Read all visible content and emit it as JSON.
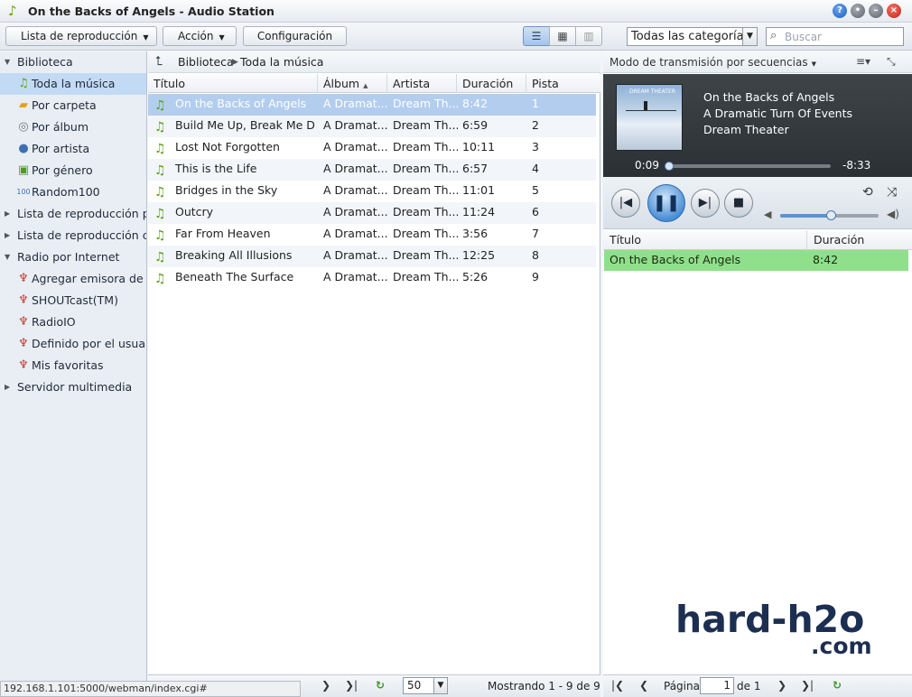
{
  "window": {
    "title": "On the Backs of Angels - Audio Station",
    "icon": "music-note-icon"
  },
  "toolbar": {
    "playlist_label": "Lista de reproducción",
    "action_label": "Acción",
    "settings_label": "Configuración",
    "category_value": "Todas las categorías",
    "search_placeholder": "Buscar"
  },
  "sidebar": {
    "library": {
      "label": "Biblioteca",
      "expanded": true
    },
    "library_items": [
      {
        "label": "Toda la música",
        "icon": "music-note-icon",
        "selected": true
      },
      {
        "label": "Por carpeta",
        "icon": "folder-icon"
      },
      {
        "label": "Por álbum",
        "icon": "disc-icon"
      },
      {
        "label": "Por artista",
        "icon": "person-icon"
      },
      {
        "label": "Por género",
        "icon": "genre-grid-icon"
      },
      {
        "label": "Random100",
        "icon": "random-100-icon"
      }
    ],
    "playlist_personal": "Lista de reproducción per",
    "playlist_shared": "Lista de reproducción cor",
    "radio": {
      "label": "Radio por Internet",
      "expanded": true
    },
    "radio_items": [
      {
        "label": "Agregar emisora de ra",
        "icon": "radio-tower-add-icon"
      },
      {
        "label": "SHOUTcast(TM)",
        "icon": "radio-tower-icon"
      },
      {
        "label": "RadioIO",
        "icon": "radio-tower-icon"
      },
      {
        "label": "Definido por el usuario",
        "icon": "radio-tower-icon"
      },
      {
        "label": "Mis favoritas",
        "icon": "radio-tower-icon"
      }
    ],
    "media_server": "Servidor multimedia"
  },
  "breadcrumb": {
    "root": "Biblioteca",
    "current": "Toda la música"
  },
  "table": {
    "columns": [
      "Título",
      "Álbum",
      "Artista",
      "Duración",
      "Pista"
    ],
    "sorted_column": "Álbum",
    "sort_direction": "ascending",
    "rows": [
      {
        "title": "On the Backs of Angels",
        "album": "A Dramat...",
        "artist": "Dream Th...",
        "duration": "8:42",
        "track": "1"
      },
      {
        "title": "Build Me Up, Break Me D...",
        "album": "A Dramat...",
        "artist": "Dream Th...",
        "duration": "6:59",
        "track": "2"
      },
      {
        "title": "Lost Not Forgotten",
        "album": "A Dramat...",
        "artist": "Dream Th...",
        "duration": "10:11",
        "track": "3"
      },
      {
        "title": "This is the Life",
        "album": "A Dramat...",
        "artist": "Dream Th...",
        "duration": "6:57",
        "track": "4"
      },
      {
        "title": "Bridges in the Sky",
        "album": "A Dramat...",
        "artist": "Dream Th...",
        "duration": "11:01",
        "track": "5"
      },
      {
        "title": "Outcry",
        "album": "A Dramat...",
        "artist": "Dream Th...",
        "duration": "11:24",
        "track": "6"
      },
      {
        "title": "Far From Heaven",
        "album": "A Dramat...",
        "artist": "Dream Th...",
        "duration": "3:56",
        "track": "7"
      },
      {
        "title": "Breaking All Illusions",
        "album": "A Dramat...",
        "artist": "Dream Th...",
        "duration": "12:25",
        "track": "8"
      },
      {
        "title": "Beneath The Surface",
        "album": "A Dramat...",
        "artist": "Dream Th...",
        "duration": "5:26",
        "track": "9"
      }
    ],
    "selected_index": 0
  },
  "center_footer": {
    "page_size": "50",
    "showing": "Mostrando 1 - 9 de 9",
    "status_url": "192.168.1.101:5000/webman/index.cgi#"
  },
  "player": {
    "stream_mode": "Modo de transmisión por secuencias",
    "now_playing": {
      "title": "On the Backs of Angels",
      "album": "A Dramatic Turn Of Events",
      "artist": "Dream Theater",
      "cover_band": "DREAM THEATER"
    },
    "elapsed": "0:09",
    "remaining": "-8:33",
    "progress_fraction": 0.017,
    "volume_fraction": 0.51
  },
  "queue": {
    "columns": [
      "Título",
      "Duración"
    ],
    "rows": [
      {
        "title": "On the Backs of Angels",
        "duration": "8:42"
      }
    ],
    "highlight_color": "#8fe08a"
  },
  "queue_footer": {
    "page_label": "Página",
    "page_value": "1",
    "page_of": "de 1"
  },
  "watermark": {
    "main": "hard-h2o",
    "sub": ".com"
  },
  "colors": {
    "selection": "#c3daf4",
    "row_selected": "#b3cdee",
    "note_green": "#5da21a",
    "now_playing_bg": "#2b3034"
  }
}
